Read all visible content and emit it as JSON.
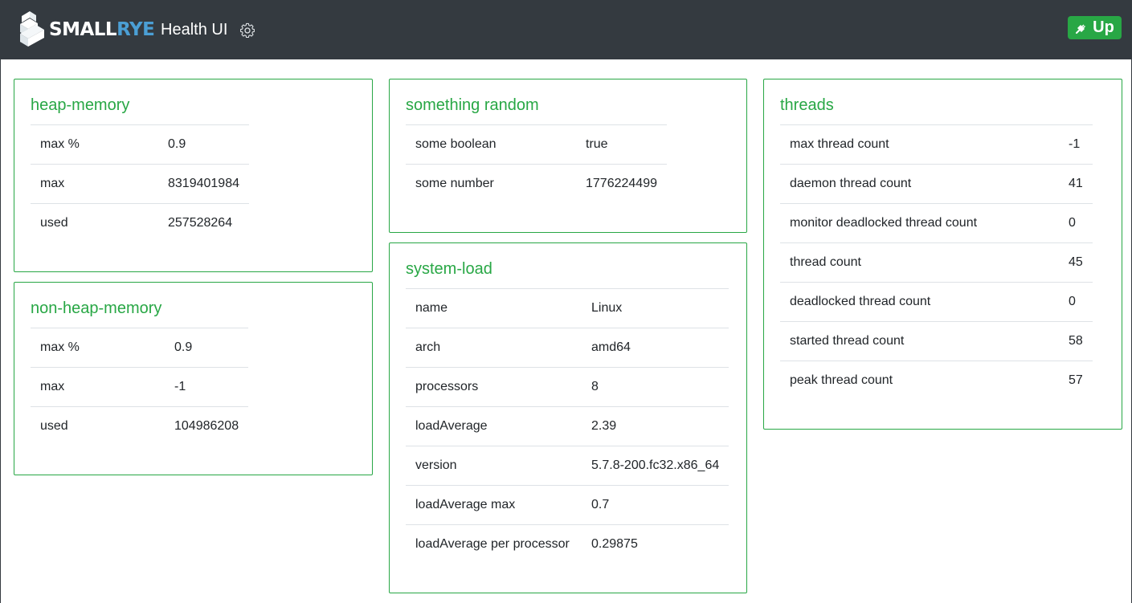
{
  "header": {
    "logo_text_small": "SMALL",
    "logo_text_rye": "RYE",
    "title": "Health UI",
    "status": "Up",
    "colors": {
      "navbar": "#343a40",
      "accent": "#28a745",
      "logo_blue": "#4b9fd5"
    },
    "icons": {
      "settings": "gear-icon",
      "status": "plug-icon"
    }
  },
  "cards": {
    "heap": {
      "title": "heap-memory",
      "rows": [
        {
          "key": "max %",
          "value": "0.9"
        },
        {
          "key": "max",
          "value": "8319401984"
        },
        {
          "key": "used",
          "value": "257528264"
        }
      ]
    },
    "nonheap": {
      "title": "non-heap-memory",
      "rows": [
        {
          "key": "max %",
          "value": "0.9"
        },
        {
          "key": "max",
          "value": "-1"
        },
        {
          "key": "used",
          "value": "104986208"
        }
      ]
    },
    "random": {
      "title": "something random",
      "rows": [
        {
          "key": "some boolean",
          "value": "true"
        },
        {
          "key": "some number",
          "value": "1776224499"
        }
      ]
    },
    "sysload": {
      "title": "system-load",
      "rows": [
        {
          "key": "name",
          "value": "Linux"
        },
        {
          "key": "arch",
          "value": "amd64"
        },
        {
          "key": "processors",
          "value": "8"
        },
        {
          "key": "loadAverage",
          "value": "2.39"
        },
        {
          "key": "version",
          "value": "5.7.8-200.fc32.x86_64"
        },
        {
          "key": "loadAverage max",
          "value": "0.7"
        },
        {
          "key": "loadAverage per processor",
          "value": "0.29875"
        }
      ]
    },
    "threads": {
      "title": "threads",
      "rows": [
        {
          "key": "max thread count",
          "value": "-1"
        },
        {
          "key": "daemon thread count",
          "value": "41"
        },
        {
          "key": "monitor deadlocked thread count",
          "value": "0"
        },
        {
          "key": "thread count",
          "value": "45"
        },
        {
          "key": "deadlocked thread count",
          "value": "0"
        },
        {
          "key": "started thread count",
          "value": "58"
        },
        {
          "key": "peak thread count",
          "value": "57"
        }
      ]
    }
  }
}
